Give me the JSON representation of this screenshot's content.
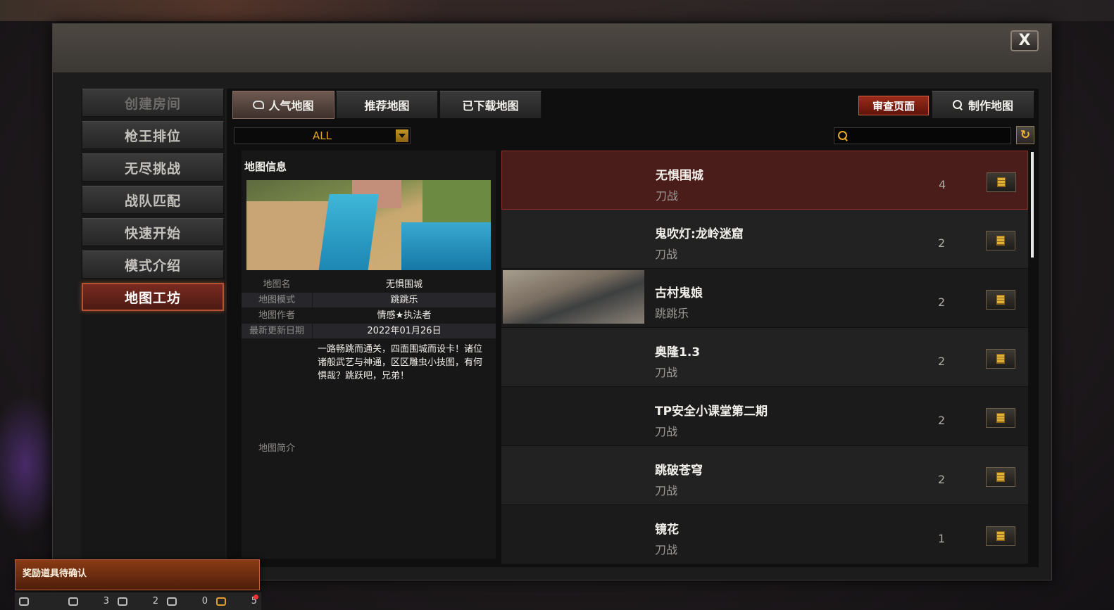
{
  "window": {
    "close_label": "X"
  },
  "nav": {
    "items": [
      {
        "label": "创建房间",
        "state": "disabled"
      },
      {
        "label": "枪王排位",
        "state": "normal"
      },
      {
        "label": "无尽挑战",
        "state": "normal"
      },
      {
        "label": "战队匹配",
        "state": "normal"
      },
      {
        "label": "快速开始",
        "state": "normal"
      },
      {
        "label": "模式介绍",
        "state": "normal"
      },
      {
        "label": "地图工坊",
        "state": "active"
      }
    ]
  },
  "tabs": [
    {
      "label": "人气地图",
      "active": true
    },
    {
      "label": "推荐地图",
      "active": false
    },
    {
      "label": "已下载地图",
      "active": false
    }
  ],
  "toolbar": {
    "review_label": "审查页面",
    "make_label": "制作地图",
    "filter_value": "ALL",
    "search_placeholder": ""
  },
  "info": {
    "title": "地图信息",
    "rows": [
      {
        "label": "地图名",
        "value": "无惧围城"
      },
      {
        "label": "地图模式",
        "value": "跳跳乐"
      },
      {
        "label": "地图作者",
        "value": "情感★执法者"
      },
      {
        "label": "最新更新日期",
        "value": "2022年01月26日"
      }
    ],
    "desc_label": "地图简介",
    "desc_text": "一路畅跳而通关，四面围城而设卡！诸位诸般武艺与神通，区区雕虫小技图，有何惧哉？跳跃吧，兄弟！"
  },
  "maps": [
    {
      "name": "无惧围城",
      "mode": "刀战",
      "count": "4",
      "selected": true,
      "thumb": "none"
    },
    {
      "name": "鬼吹灯:龙岭迷窟",
      "mode": "刀战",
      "count": "2",
      "selected": false,
      "thumb": "none"
    },
    {
      "name": "古村鬼娘",
      "mode": "跳跳乐",
      "count": "2",
      "selected": false,
      "thumb": "village"
    },
    {
      "name": "奥隆1.3",
      "mode": "刀战",
      "count": "2",
      "selected": false,
      "thumb": "none"
    },
    {
      "name": "TP安全小课堂第二期",
      "mode": "刀战",
      "count": "2",
      "selected": false,
      "thumb": "none"
    },
    {
      "name": "跳破苍穹",
      "mode": "刀战",
      "count": "2",
      "selected": false,
      "thumb": "none"
    },
    {
      "name": "镜花",
      "mode": "刀战",
      "count": "1",
      "selected": false,
      "thumb": "none"
    }
  ],
  "toast": {
    "text": "奖励道具待确认"
  },
  "statusbar": {
    "items": [
      {
        "icon": "list-icon",
        "value": ""
      },
      {
        "icon": "friends-icon",
        "value": "3"
      },
      {
        "icon": "shield-icon",
        "value": "2"
      },
      {
        "icon": "chat-icon",
        "value": "0"
      },
      {
        "icon": "gift-icon",
        "value": "5"
      }
    ]
  }
}
